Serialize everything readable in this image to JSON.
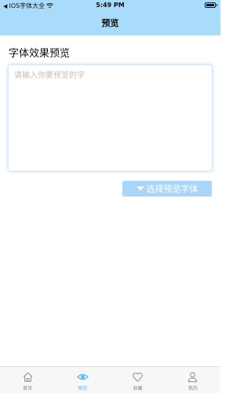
{
  "status_bar": {
    "carrier": "IOS字体大全",
    "time": "5:49 PM"
  },
  "nav": {
    "title": "预览"
  },
  "main": {
    "section_title": "字体效果预览",
    "input_placeholder": "请输入你要预览的字",
    "choose_font_label": "选择预览字体"
  },
  "tabs": [
    {
      "label": "首页",
      "icon": "home-icon",
      "active": false
    },
    {
      "label": "预览",
      "icon": "eye-icon",
      "active": true
    },
    {
      "label": "收藏",
      "icon": "heart-icon",
      "active": false
    },
    {
      "label": "我的",
      "icon": "user-icon",
      "active": false
    }
  ],
  "colors": {
    "header_bg": "#a9dcfb",
    "button_bg": "#a9d6f8",
    "active_tab": "#5bb8f5",
    "inactive_tab": "#888888"
  }
}
